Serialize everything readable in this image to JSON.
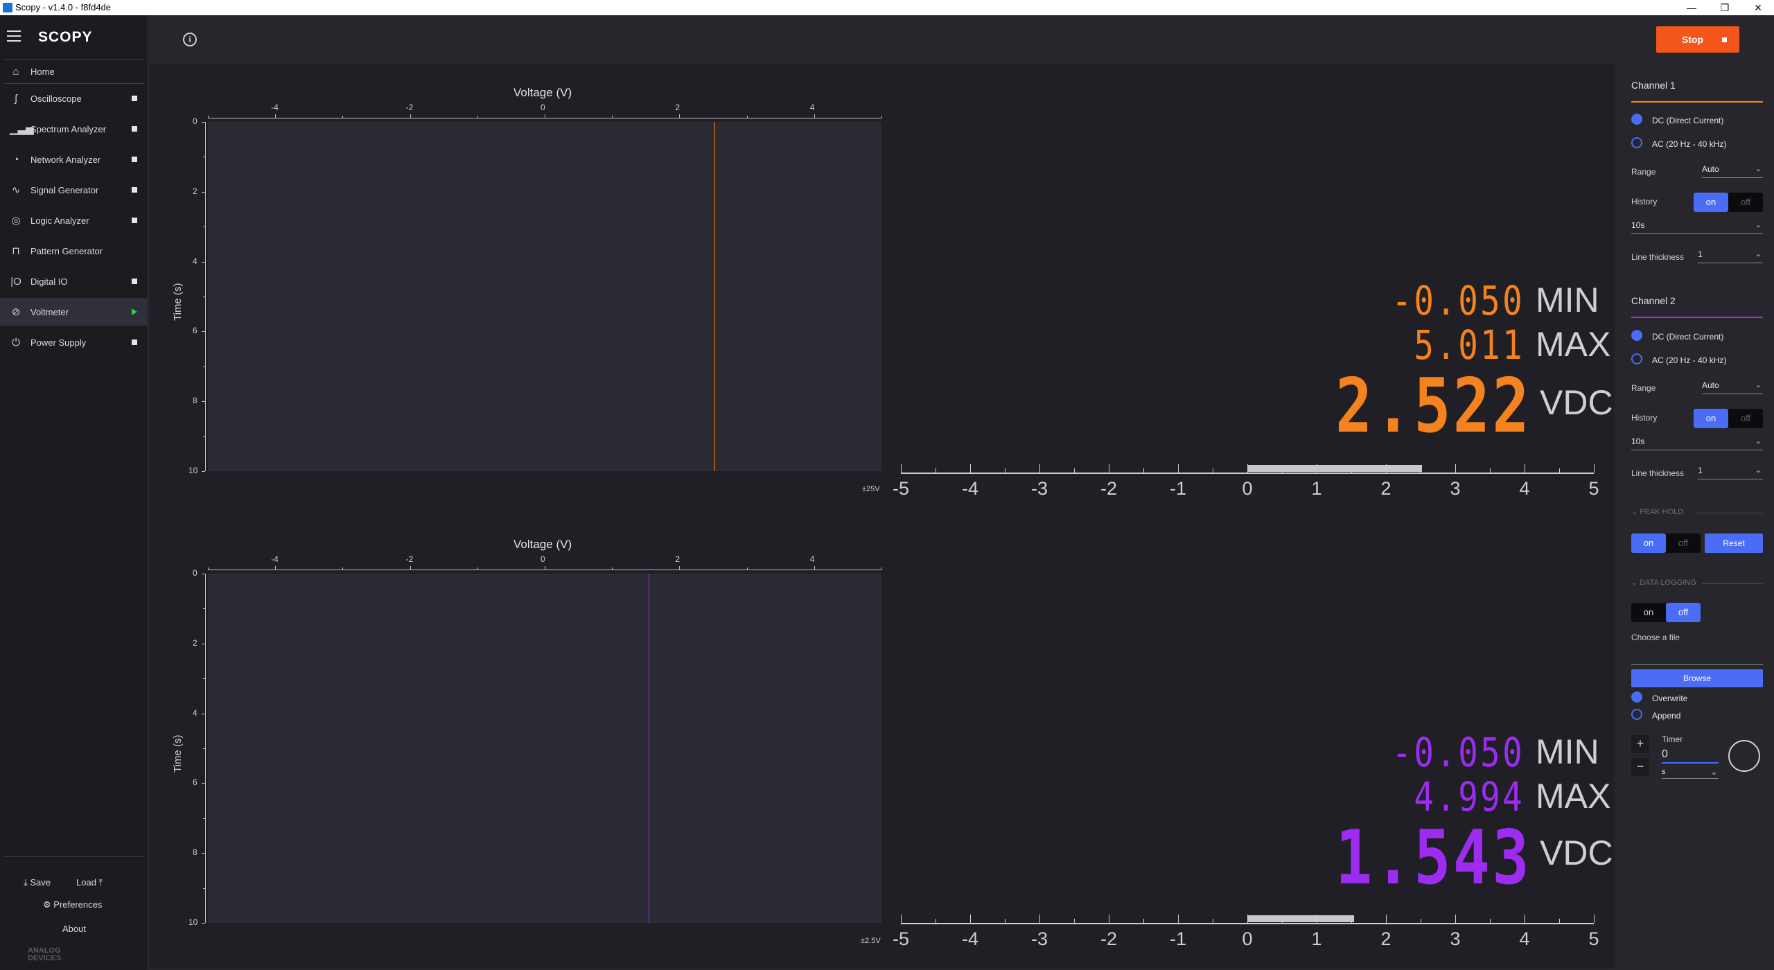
{
  "window": {
    "title": "Scopy - v1.4.0 - f8fd4de",
    "minimize": "—",
    "restore": "❐",
    "close": "✕"
  },
  "app": {
    "logo": "SCOPY"
  },
  "sidebar": {
    "home": "Home",
    "items": [
      {
        "label": "Oscilloscope",
        "icon": "oscilloscope-icon",
        "status": "stopped"
      },
      {
        "label": "Spectrum Analyzer",
        "icon": "spectrum-icon",
        "status": "stopped"
      },
      {
        "label": "Network Analyzer",
        "icon": "network-icon",
        "status": "stopped"
      },
      {
        "label": "Signal Generator",
        "icon": "signal-icon",
        "status": "stopped"
      },
      {
        "label": "Logic Analyzer",
        "icon": "logic-icon",
        "status": "stopped"
      },
      {
        "label": "Pattern Generator",
        "icon": "pattern-icon",
        "status": "none"
      },
      {
        "label": "Digital IO",
        "icon": "dio-icon",
        "status": "stopped"
      },
      {
        "label": "Voltmeter",
        "icon": "voltmeter-icon",
        "status": "running"
      },
      {
        "label": "Power Supply",
        "icon": "power-icon",
        "status": "stopped"
      }
    ],
    "save": "Save",
    "load": "Load",
    "preferences": "Preferences",
    "about": "About",
    "brand_line1": "ANALOG",
    "brand_line2": "DEVICES"
  },
  "toolbar": {
    "stop_label": "Stop"
  },
  "plots": [
    {
      "title": "Voltage (V)",
      "ylabel": "Time (s)",
      "xticks": [
        "-4",
        "-2",
        "0",
        "2",
        "4"
      ],
      "yticks": [
        "0",
        "2",
        "4",
        "6",
        "8",
        "10"
      ],
      "xrange": [
        -5,
        5
      ],
      "yrange": [
        0,
        10
      ],
      "trace_value": 2.522,
      "color": "#f4821f",
      "scale": "±25V"
    },
    {
      "title": "Voltage (V)",
      "ylabel": "Time (s)",
      "xticks": [
        "-4",
        "-2",
        "0",
        "2",
        "4"
      ],
      "yticks": [
        "0",
        "2",
        "4",
        "6",
        "8",
        "10"
      ],
      "xrange": [
        -5,
        5
      ],
      "yrange": [
        0,
        10
      ],
      "trace_value": 1.543,
      "color": "#9b2cf0",
      "scale": "±2.5V"
    }
  ],
  "readouts": [
    {
      "min": "-0.050",
      "max": "5.011",
      "value": "2.522",
      "min_unit": "MIN",
      "max_unit": "MAX",
      "unit": "VDC",
      "color": "#f4821f",
      "bar_value": 2.522
    },
    {
      "min": "-0.050",
      "max": "4.994",
      "value": "1.543",
      "min_unit": "MIN",
      "max_unit": "MAX",
      "unit": "VDC",
      "color": "#9b2cf0",
      "bar_value": 1.543
    }
  ],
  "bar_scale": {
    "labels": [
      "-5",
      "-4",
      "-3",
      "-2",
      "-1",
      "0",
      "1",
      "2",
      "3",
      "4",
      "5"
    ],
    "range": [
      -5,
      5
    ]
  },
  "panel": {
    "channels": [
      {
        "title": "Channel 1",
        "color": "#f4821f",
        "dc": "DC (Direct Current)",
        "ac": "AC (20 Hz - 40 kHz)",
        "mode": "dc",
        "range_label": "Range",
        "range_value": "Auto",
        "history_label": "History",
        "history_on": "on",
        "history_off": "off",
        "history_duration": "10s",
        "thickness_label": "Line thickness",
        "thickness_value": "1"
      },
      {
        "title": "Channel 2",
        "color": "#9b2cf0",
        "dc": "DC (Direct Current)",
        "ac": "AC (20 Hz - 40 kHz)",
        "mode": "dc",
        "range_label": "Range",
        "range_value": "Auto",
        "history_label": "History",
        "history_on": "on",
        "history_off": "off",
        "history_duration": "10s",
        "thickness_label": "Line thickness",
        "thickness_value": "1"
      }
    ],
    "peak_hold": {
      "header": "PEAK HOLD",
      "on": "on",
      "off": "off",
      "reset": "Reset"
    },
    "data_logging": {
      "header": "DATA LOGGING",
      "on": "on",
      "off": "off",
      "choose_file": "Choose a file",
      "browse": "Browse",
      "overwrite": "Overwrite",
      "append": "Append",
      "timer_label": "Timer",
      "timer_value": "0",
      "timer_unit": "s",
      "plus": "+",
      "minus": "−"
    }
  }
}
